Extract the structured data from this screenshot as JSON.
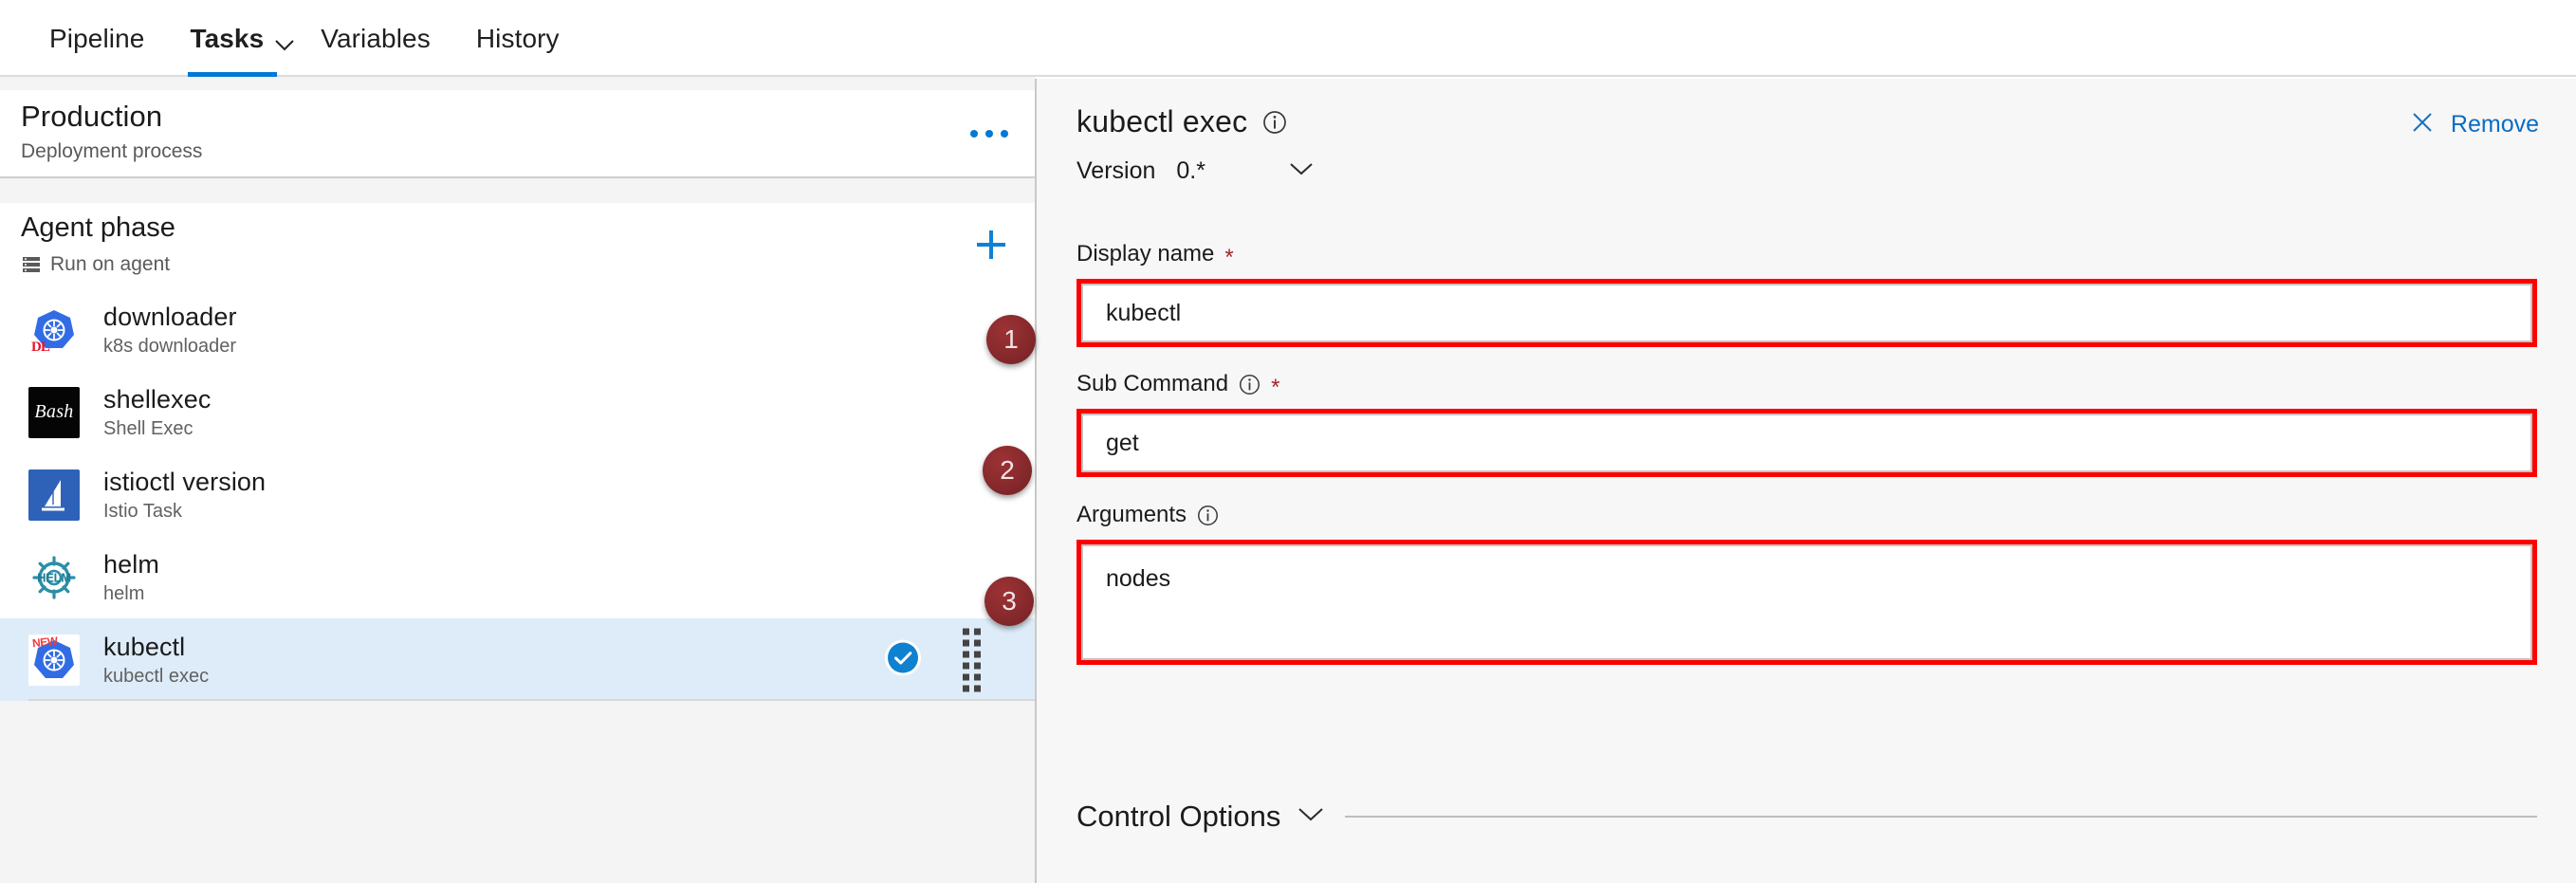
{
  "tabs": [
    {
      "label": "Pipeline",
      "active": false,
      "has_caret": false
    },
    {
      "label": "Tasks",
      "active": true,
      "has_caret": true
    },
    {
      "label": "Variables",
      "active": false,
      "has_caret": false
    },
    {
      "label": "History",
      "active": false,
      "has_caret": false
    }
  ],
  "sidebar": {
    "process": {
      "title": "Production",
      "subtitle": "Deployment process",
      "more_menu": "…"
    },
    "phase": {
      "title": "Agent phase",
      "subtitle": "Run on agent",
      "add_label": "+"
    },
    "tasks": [
      {
        "name": "downloader",
        "desc": "k8s downloader",
        "icon": "kubernetes-icon",
        "badge": "DL",
        "selected": false
      },
      {
        "name": "shellexec",
        "desc": "Shell Exec",
        "icon": "bash-icon",
        "badge": "Bash",
        "selected": false
      },
      {
        "name": "istioctl version",
        "desc": "Istio Task",
        "icon": "istio-icon",
        "badge": "",
        "selected": false
      },
      {
        "name": "helm",
        "desc": "helm",
        "icon": "helm-icon",
        "badge": "HELM",
        "selected": false
      },
      {
        "name": "kubectl",
        "desc": "kubectl exec",
        "icon": "kubernetes-icon",
        "badge": "NEW",
        "selected": true
      }
    ]
  },
  "detail": {
    "title": "kubectl exec",
    "info_icon": "info-icon",
    "remove_label": "Remove",
    "remove_icon": "close-icon",
    "version_label": "Version",
    "version_value": "0.*",
    "fields": [
      {
        "label": "Display name",
        "required": true,
        "has_info": false,
        "value": "kubectl",
        "type": "input",
        "highlighted": true
      },
      {
        "label": "Sub Command",
        "required": true,
        "has_info": true,
        "value": "get",
        "type": "input",
        "highlighted": true
      },
      {
        "label": "Arguments",
        "required": false,
        "has_info": true,
        "value": "nodes",
        "type": "textarea",
        "highlighted": true
      }
    ],
    "control_options": {
      "title": "Control Options",
      "expanded": false
    }
  },
  "annotations": [
    {
      "number": "1",
      "target": "display-name-field"
    },
    {
      "number": "2",
      "target": "sub-command-field"
    },
    {
      "number": "3",
      "target": "arguments-field"
    }
  ],
  "colors": {
    "accent": "#0078d4",
    "link": "#0a6cc4",
    "selected_row": "#deecf9",
    "highlight_box": "#fe0000",
    "badge": "#8b2b2e",
    "required_star": "#a4262c"
  }
}
